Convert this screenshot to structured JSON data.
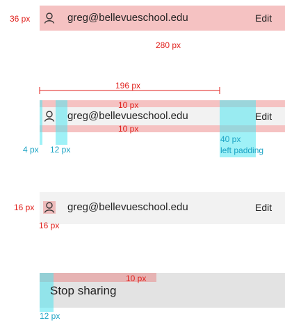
{
  "account": {
    "email": "greg@bellevueschool.edu",
    "edit_label": "Edit",
    "icon": "person-icon"
  },
  "stop_sharing_label": "Stop sharing",
  "annotations": {
    "height_36": "36 px",
    "width_280": "280 px",
    "width_196": "196 px",
    "padding_top_10": "10 px",
    "padding_bottom_10": "10 px",
    "left_4": "4 px",
    "gap_12": "12 px",
    "right_40": "40 px",
    "right_40_note": "left padding",
    "icon_16_left": "16 px",
    "icon_16_below": "16 px",
    "stop_top_10": "10 px",
    "stop_left_12": "12 px"
  },
  "colors": {
    "row_bg": "#f2f2f2",
    "stop_bg": "#e3e3e3",
    "annotation_red": "#e0201c",
    "annotation_blue": "#1aa3c4"
  }
}
